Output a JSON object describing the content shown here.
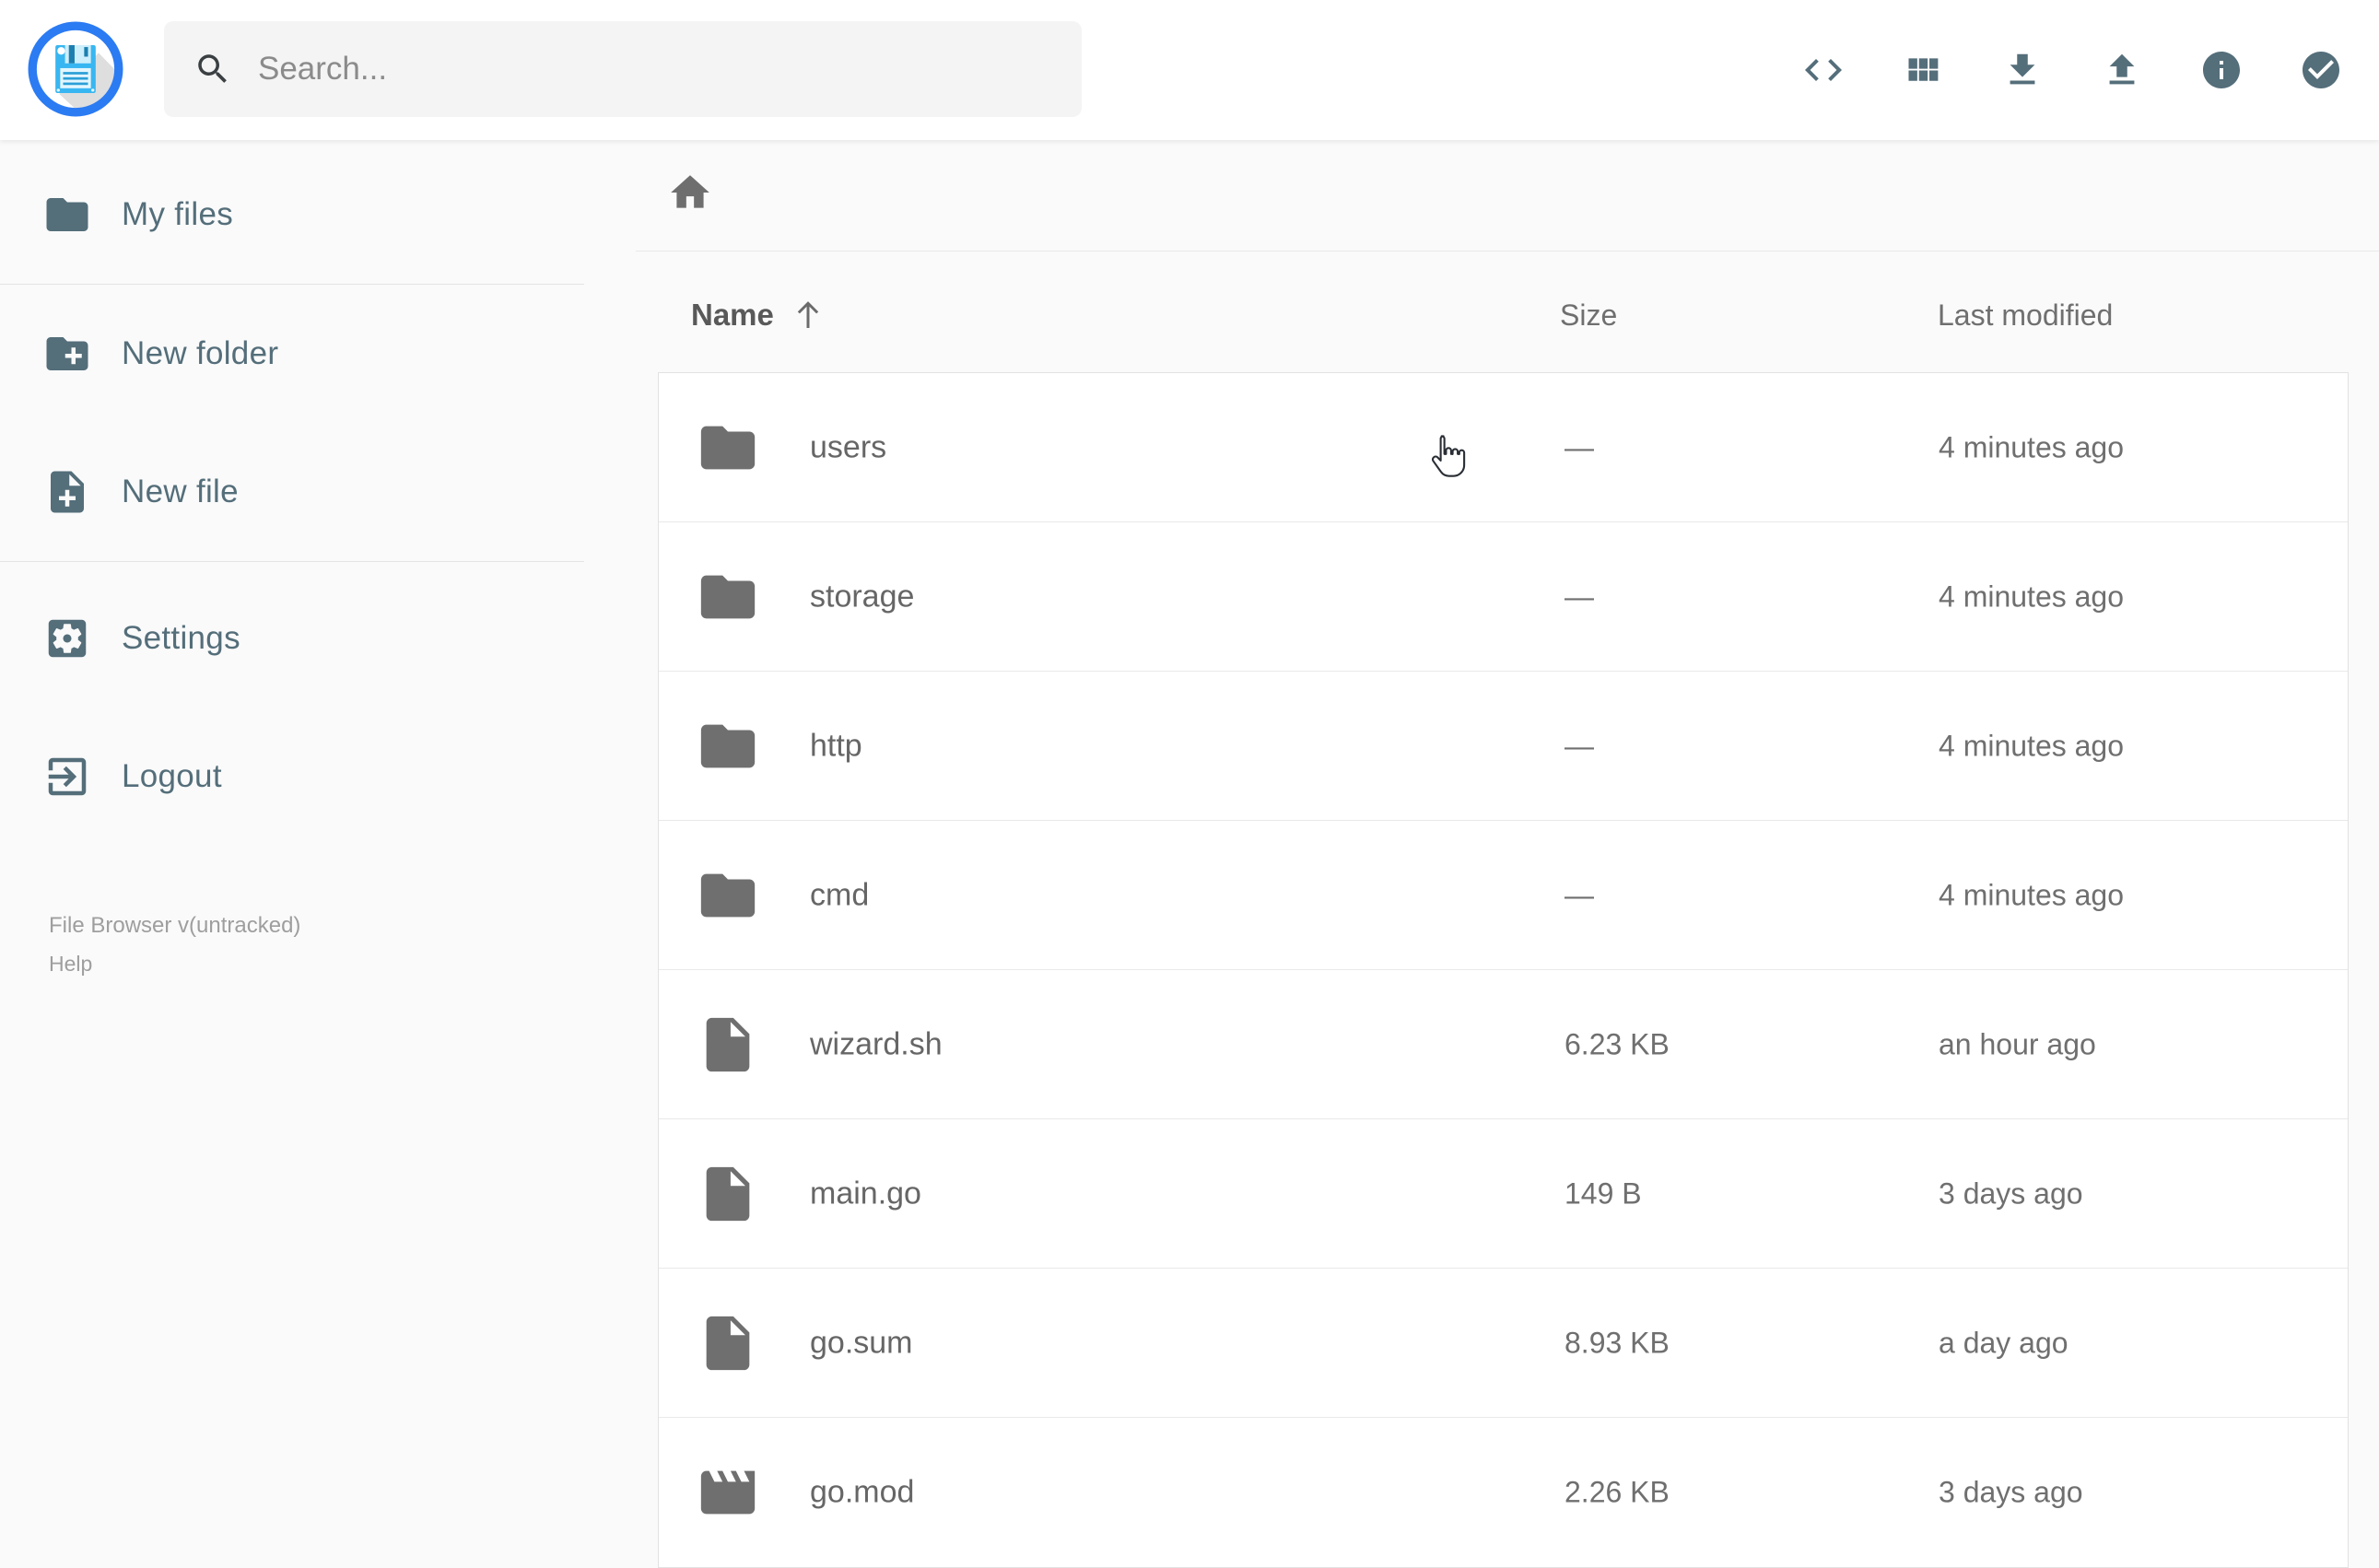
{
  "app": {
    "logo_icon": "floppy-disk-icon"
  },
  "topbar": {
    "search": {
      "placeholder": "Search...",
      "icon": "search-icon"
    },
    "actions": [
      {
        "id": "shell",
        "icon": "code-icon"
      },
      {
        "id": "switch-view",
        "icon": "grid-view-icon"
      },
      {
        "id": "download",
        "icon": "download-icon"
      },
      {
        "id": "upload",
        "icon": "upload-icon"
      },
      {
        "id": "info",
        "icon": "info-icon"
      },
      {
        "id": "select-multiple",
        "icon": "check-circle-icon"
      }
    ]
  },
  "sidebar": {
    "items": [
      {
        "label": "My files",
        "icon": "folder-icon"
      },
      {
        "label": "New folder",
        "icon": "folder-plus-icon"
      },
      {
        "label": "New file",
        "icon": "file-plus-icon"
      },
      {
        "label": "Settings",
        "icon": "gear-icon"
      },
      {
        "label": "Logout",
        "icon": "logout-icon"
      }
    ],
    "footer": {
      "version": "File Browser v(untracked)",
      "help": "Help"
    }
  },
  "breadcrumb": {
    "home_icon": "home-icon"
  },
  "listing": {
    "columns": {
      "name": "Name",
      "size": "Size",
      "modified": "Last modified"
    },
    "sort": {
      "column": "name",
      "direction": "ascending",
      "icon": "arrow-up-icon"
    },
    "rows": [
      {
        "name": "users",
        "type": "folder",
        "icon": "folder-icon",
        "size": "—",
        "modified": "4 minutes ago"
      },
      {
        "name": "storage",
        "type": "folder",
        "icon": "folder-icon",
        "size": "—",
        "modified": "4 minutes ago"
      },
      {
        "name": "http",
        "type": "folder",
        "icon": "folder-icon",
        "size": "—",
        "modified": "4 minutes ago"
      },
      {
        "name": "cmd",
        "type": "folder",
        "icon": "folder-icon",
        "size": "—",
        "modified": "4 minutes ago"
      },
      {
        "name": "wizard.sh",
        "type": "file",
        "icon": "file-icon",
        "size": "6.23 KB",
        "modified": "an hour ago"
      },
      {
        "name": "main.go",
        "type": "file",
        "icon": "file-icon",
        "size": "149 B",
        "modified": "3 days ago"
      },
      {
        "name": "go.sum",
        "type": "file",
        "icon": "file-icon",
        "size": "8.93 KB",
        "modified": "a day ago"
      },
      {
        "name": "go.mod",
        "type": "file",
        "icon": "movie-icon",
        "size": "2.26 KB",
        "modified": "3 days ago"
      }
    ]
  },
  "colors": {
    "accent": "#546e7a",
    "logo_ring": "#2b7bf3",
    "logo_floppy": "#38b6f1",
    "row_icon": "#6f6f6f",
    "background": "#fafafa",
    "card_border": "#e2e2e2"
  },
  "cursor": {
    "shape": "pointer-hand"
  }
}
